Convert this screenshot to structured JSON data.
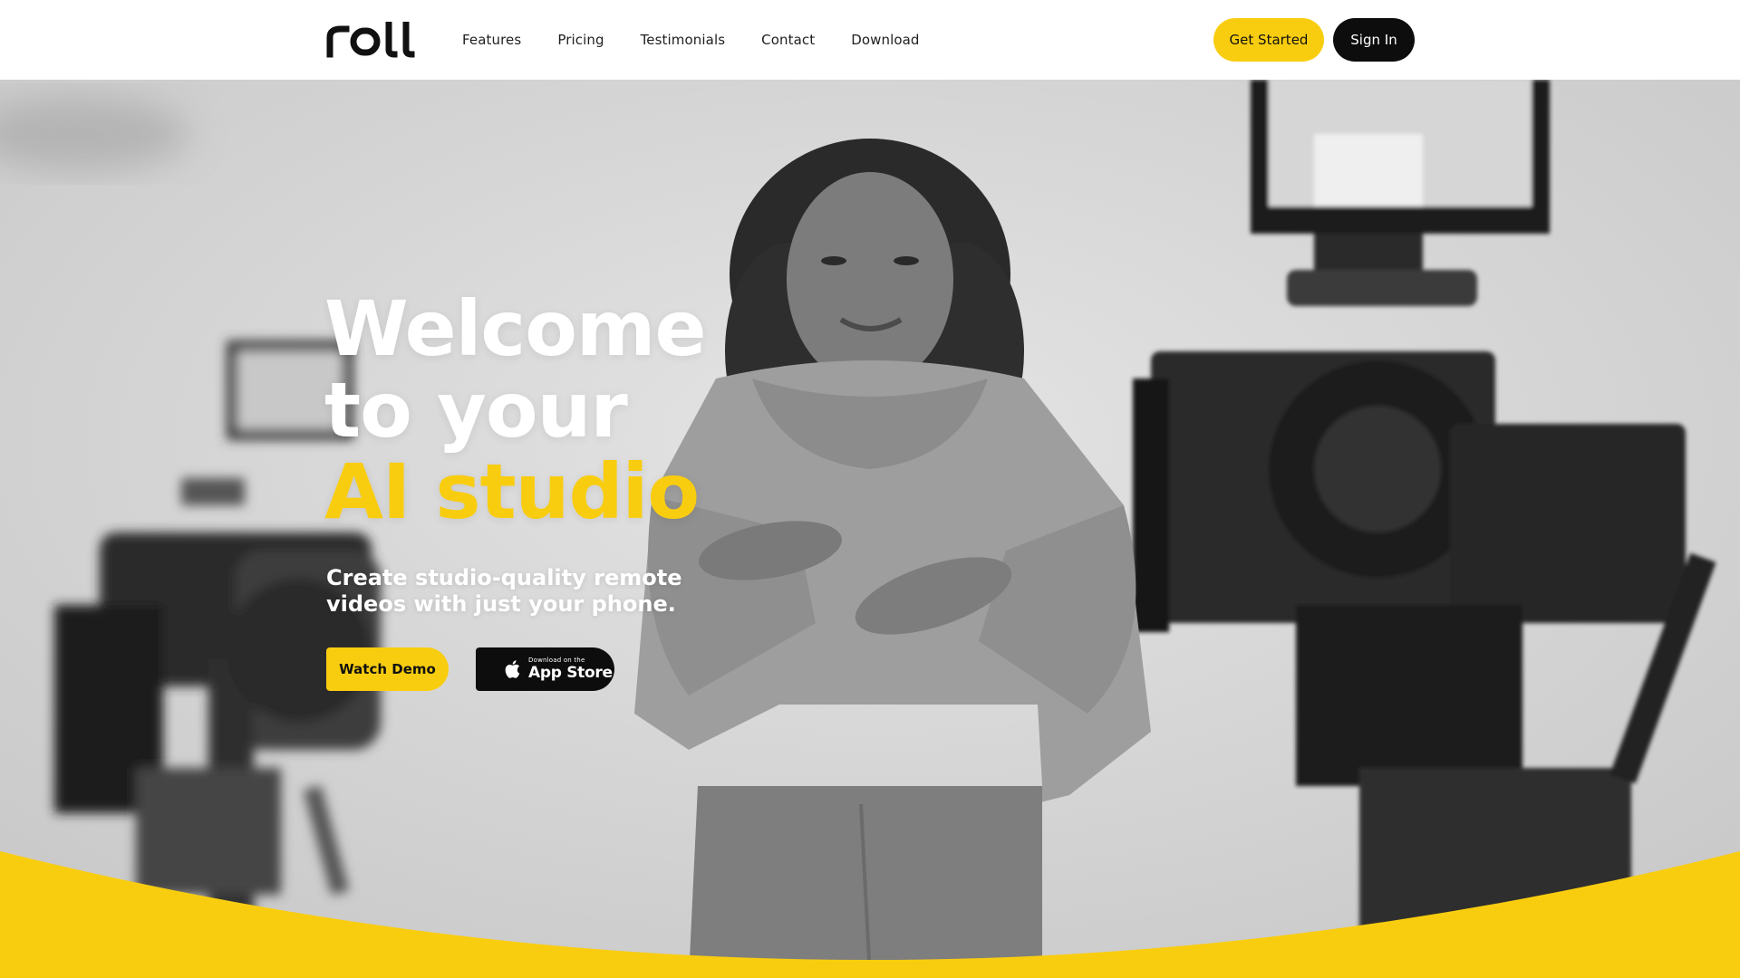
{
  "header": {
    "logo_text": "roll",
    "nav": [
      "Features",
      "Pricing",
      "Testimonials",
      "Contact",
      "Download"
    ],
    "get_started": "Get Started",
    "sign_in": "Sign In"
  },
  "hero": {
    "headline_line1": "Welcome",
    "headline_line2": "to your",
    "headline_accent": "AI studio",
    "subtitle": "Create studio-quality remote videos with just your phone.",
    "watch_demo": "Watch Demo",
    "appstore_small": "Download on the",
    "appstore_big": "App Store"
  },
  "colors": {
    "brand_yellow": "#f9cd0f",
    "dark": "#0d0d0d",
    "white": "#ffffff"
  },
  "icons": [
    "apple-icon"
  ]
}
